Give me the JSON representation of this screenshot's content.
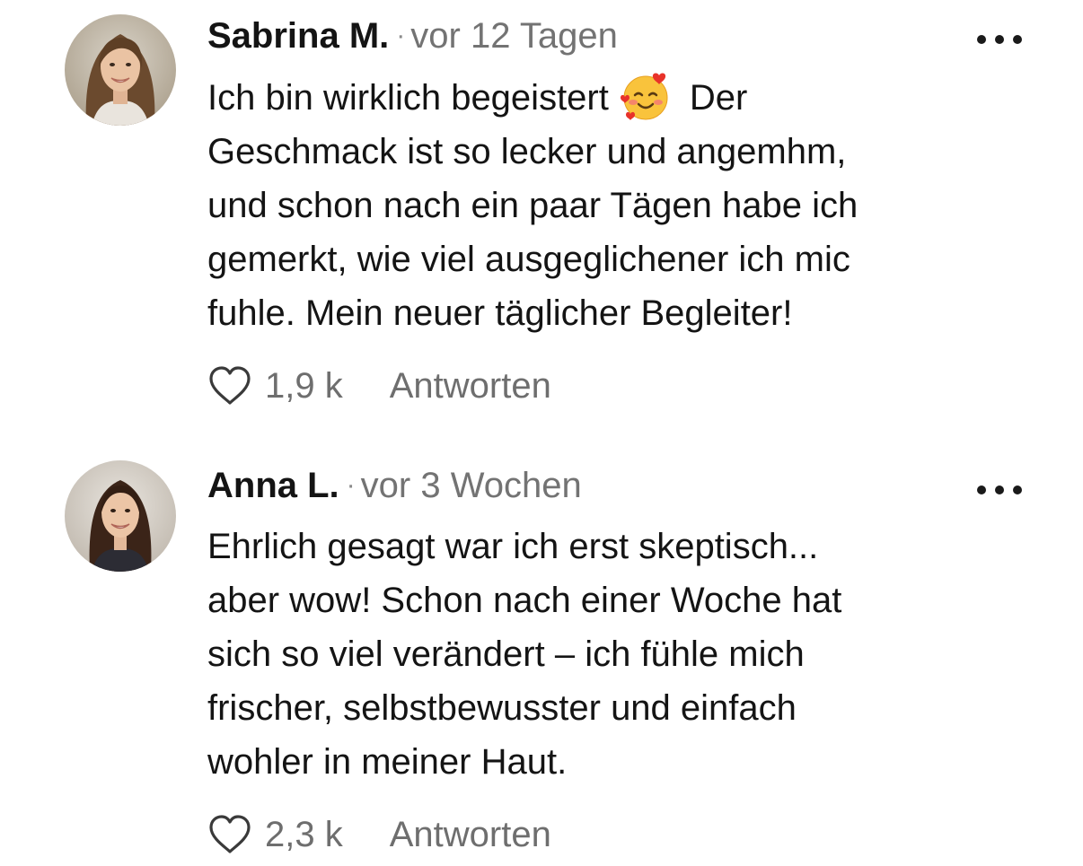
{
  "comments": [
    {
      "author": "Sabrina M.",
      "separator": "·",
      "time": "vor 12 Tagen",
      "avatar_icon": "woman-portrait-avatar",
      "emoji": "smiling-face-with-hearts",
      "lines": [
        "Ich bin wirklich begeistert",
        "Der",
        "Geschmack ist so lecker und angemhm,",
        "und schon nach ein paar Tägen habe ich",
        "gemerkt, wie viel ausgeglichener ich mic",
        "fuhle. Mein neuer täglicher Begleiter!"
      ],
      "likes": "1,9 k",
      "reply_label": "Antworten"
    },
    {
      "author": "Anna L.",
      "separator": "·",
      "time": "vor 3 Wochen",
      "avatar_icon": "woman-portrait-avatar",
      "lines": [
        "Ehrlich gesagt war ich erst skeptisch...",
        "aber wow! Schon nach einer Woche hat",
        "sich so viel verändert – ich fühle mich",
        "frischer, selbstbewusster und einfach",
        "wohler in meiner Haut."
      ],
      "likes": "2,3 k",
      "reply_label": "Antworten"
    }
  ],
  "icons": {
    "like": "heart-outline-icon",
    "more": "more-horizontal-icon"
  },
  "colors": {
    "text": "#141414",
    "muted": "#737373",
    "background": "#ffffff"
  }
}
